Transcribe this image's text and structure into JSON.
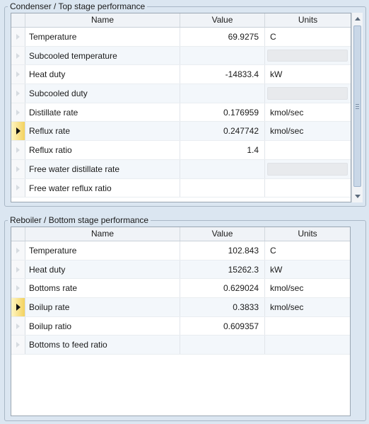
{
  "condenser": {
    "title": "Condenser / Top stage performance",
    "columns": {
      "name": "Name",
      "value": "Value",
      "units": "Units"
    },
    "rows": [
      {
        "name": "Temperature",
        "value": "69.9275",
        "units": "C"
      },
      {
        "name": "Subcooled temperature",
        "value": "",
        "units": ""
      },
      {
        "name": "Heat duty",
        "value": "-14833.4",
        "units": "kW"
      },
      {
        "name": "Subcooled duty",
        "value": "",
        "units": ""
      },
      {
        "name": "Distillate rate",
        "value": "0.176959",
        "units": "kmol/sec"
      },
      {
        "name": "Reflux rate",
        "value": "0.247742",
        "units": "kmol/sec"
      },
      {
        "name": "Reflux ratio",
        "value": "1.4",
        "units": ""
      },
      {
        "name": "Free water distillate rate",
        "value": "",
        "units": ""
      },
      {
        "name": "Free water reflux ratio",
        "value": "",
        "units": ""
      }
    ]
  },
  "reboiler": {
    "title": "Reboiler / Bottom stage performance",
    "columns": {
      "name": "Name",
      "value": "Value",
      "units": "Units"
    },
    "rows": [
      {
        "name": "Temperature",
        "value": "102.843",
        "units": "C"
      },
      {
        "name": "Heat duty",
        "value": "15262.3",
        "units": "kW"
      },
      {
        "name": "Bottoms rate",
        "value": "0.629024",
        "units": "kmol/sec"
      },
      {
        "name": "Boilup rate",
        "value": "0.3833",
        "units": "kmol/sec"
      },
      {
        "name": "Boilup ratio",
        "value": "0.609357",
        "units": ""
      },
      {
        "name": "Bottoms to feed ratio",
        "value": "",
        "units": ""
      }
    ]
  }
}
